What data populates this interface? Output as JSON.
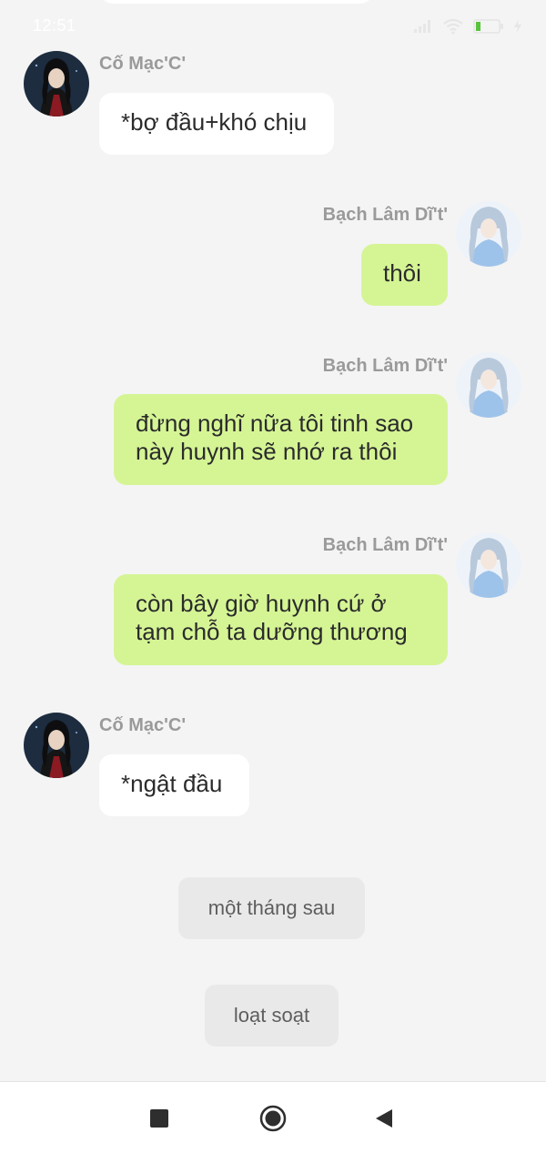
{
  "status_bar": {
    "time": "12:51",
    "icons": [
      "signal-icon",
      "wifi-icon",
      "battery-icon",
      "charging-icon"
    ]
  },
  "messages": [
    {
      "side": "left",
      "sender": "Cố Mạc'C'",
      "text": "*bợ đầu+khó chịu"
    },
    {
      "side": "right",
      "sender": "Bạch Lâm Dĩ't'",
      "text": "thôi"
    },
    {
      "side": "right",
      "sender": "Bạch Lâm Dĩ't'",
      "text": "đừng nghĩ nữa tôi tinh sao\nnày huynh sẽ nhớ ra thôi"
    },
    {
      "side": "right",
      "sender": "Bạch Lâm Dĩ't'",
      "text": "còn bây giờ huynh cứ ở\ntạm chỗ ta dưỡng thương"
    },
    {
      "side": "left",
      "sender": "Cố Mạc'C'",
      "text": "*ngật đầu"
    }
  ],
  "system_messages": [
    "một tháng sau",
    "loạt soạt"
  ],
  "nav_bar": {
    "buttons": [
      "recent-apps-icon",
      "home-icon",
      "back-icon"
    ]
  },
  "colors": {
    "background": "#f4f4f4",
    "bubble_right": "#d5f595",
    "bubble_left": "#ffffff",
    "pill": "#e9e9e9",
    "name": "#9a9a9a"
  }
}
